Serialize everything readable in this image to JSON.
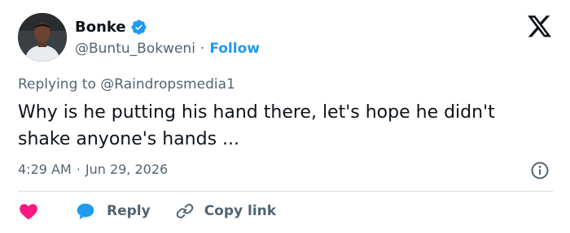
{
  "author": {
    "name": "Bonke",
    "handle": "@Buntu_Bokweni",
    "separator": "·",
    "follow_label": "Follow",
    "verified": true
  },
  "brand_icon": "x-logo-icon",
  "reply": {
    "prefix": "Replying to",
    "mention": "@Raindropsmedia1"
  },
  "tweet": {
    "text": "Why is he putting his hand there, let's hope he didn't shake anyone's hands ..."
  },
  "meta": {
    "time": "4:29 AM",
    "separator": "·",
    "date": "Jun 29, 2026"
  },
  "actions": {
    "like_icon": "heart-icon",
    "reply_label": "Reply",
    "copy_label": "Copy link"
  },
  "colors": {
    "accent": "#1d9bf0",
    "like": "#f91880",
    "text": "#0f1419",
    "muted": "#536471",
    "divider": "#cfd9de"
  }
}
